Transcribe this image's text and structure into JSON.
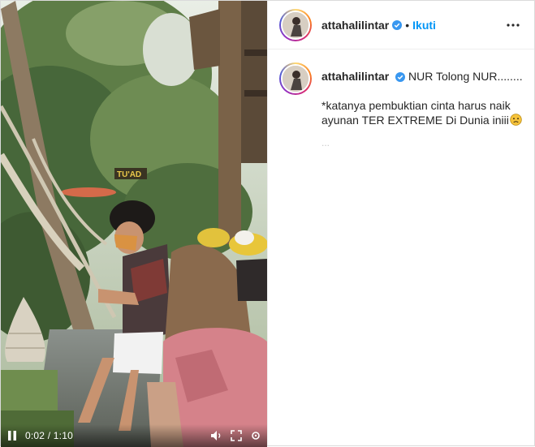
{
  "post": {
    "username": "attahalilintar",
    "verified": true,
    "follow_separator": "•",
    "follow_label": "Ikuti",
    "more_icon": "more-horizontal-icon"
  },
  "caption": {
    "username": "attahalilintar",
    "line1": "NUR Tolong NUR........",
    "line2": "*katanya pembuktian cinta harus naik ayunan TER EXTREME Di Dunia iniii",
    "emoji": "worried-face-emoji",
    "faded_text": "..."
  },
  "video": {
    "time_current": "0:02",
    "time_separator": "/",
    "time_total": "1:10",
    "sign_text": "TU'AD",
    "state": "paused"
  },
  "colors": {
    "follow": "#0095f6",
    "verified": "#3897f0",
    "text": "#262626",
    "border": "#dbdbdb"
  }
}
